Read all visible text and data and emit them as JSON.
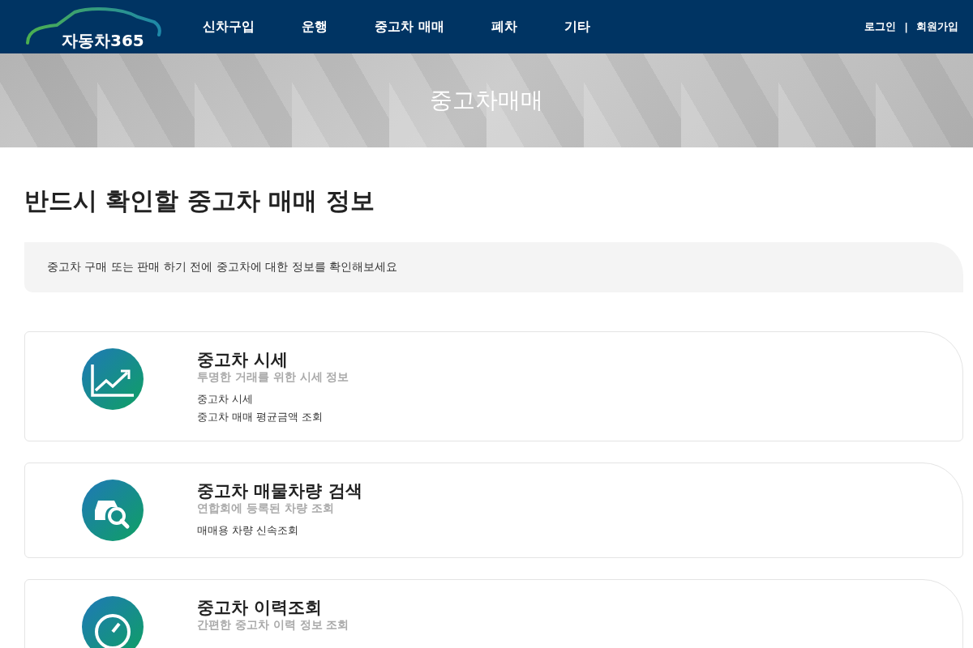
{
  "header": {
    "logo": "자동차365",
    "nav": [
      {
        "label": "신차구입"
      },
      {
        "label": "운행"
      },
      {
        "label": "중고차 매매"
      },
      {
        "label": "폐차"
      },
      {
        "label": "기타"
      }
    ],
    "auth": [
      "로그인",
      "|",
      "회원가입"
    ]
  },
  "hero": {
    "title": "중고차매매"
  },
  "section": {
    "heading": "반드시 확인할 중고차 매매 정보",
    "notice": "중고차 구매 또는 판매 하기 전에 중고차에 대한 정보를 확인해보세요"
  },
  "cards": [
    {
      "kind": "chart",
      "title": "중고차 시세",
      "subtitle": "투명한 거래를 위한 시세 정보",
      "links": [
        "중고차 시세",
        "중고차 매매 평균금액 조회"
      ]
    },
    {
      "kind": "car-search",
      "title": "중고차 매물차량 검색",
      "subtitle": "연합회에 등록된 차량 조회",
      "links": [
        "매매용 차량 신속조회"
      ]
    },
    {
      "kind": "gauge",
      "title": "중고차 이력조회",
      "subtitle": "간편한 중고차 이력 정보 조회"
    }
  ]
}
